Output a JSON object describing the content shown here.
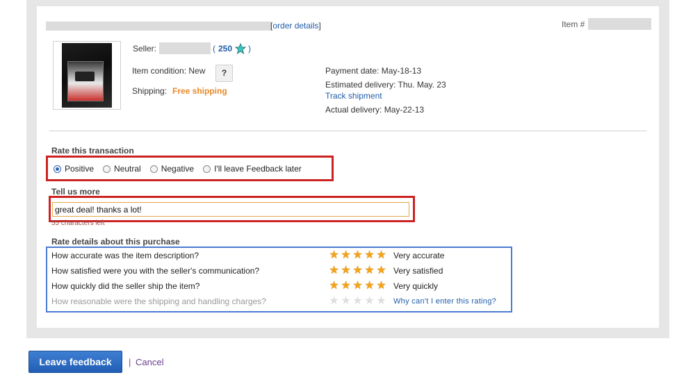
{
  "header": {
    "order_details_open": "[",
    "order_details_link": "order details",
    "order_details_close": "]",
    "item_label": "Item #"
  },
  "item": {
    "seller_label": "Seller:",
    "seller_score": "250",
    "paren_open": "(",
    "paren_close": ")",
    "condition_label": "Item condition: New",
    "help_label": "?",
    "shipping_label": "Shipping:",
    "shipping_value": "Free shipping",
    "payment_date": "Payment date: May-18-13",
    "estimated_delivery": "Estimated delivery: Thu. May. 23",
    "track_link": "Track shipment",
    "actual_delivery": "Actual delivery: May-22-13"
  },
  "rate": {
    "title": "Rate this transaction",
    "options": [
      "Positive",
      "Neutral",
      "Negative",
      "I'll leave Feedback later"
    ],
    "selected": "Positive"
  },
  "comment": {
    "title": "Tell us more",
    "value": "great deal! thanks a lot!",
    "counter": "55 characters left"
  },
  "details": {
    "title": "Rate details about this purchase",
    "questions": [
      {
        "text": "How accurate was the item description?",
        "rating": 5,
        "label": "Very accurate"
      },
      {
        "text": "How satisfied were you with the seller's communication?",
        "rating": 5,
        "label": "Very satisfied"
      },
      {
        "text": "How quickly did the seller ship the item?",
        "rating": 5,
        "label": "Very quickly"
      },
      {
        "text": "How reasonable were the shipping and handling charges?",
        "rating": 0,
        "label": "Why can't I enter this rating?",
        "disabled": true
      }
    ]
  },
  "actions": {
    "leave_feedback": "Leave feedback",
    "separator": "|",
    "cancel": "Cancel"
  },
  "colors": {
    "accent_blue": "#1f5ca8",
    "shipping_orange": "#e8892a",
    "star_gold": "#f2a21b",
    "highlight_red": "#cc2222",
    "highlight_blue": "#4a7bd0"
  },
  "icons": {
    "seller_star": "teal-star-icon",
    "rating_star": "star-icon"
  }
}
